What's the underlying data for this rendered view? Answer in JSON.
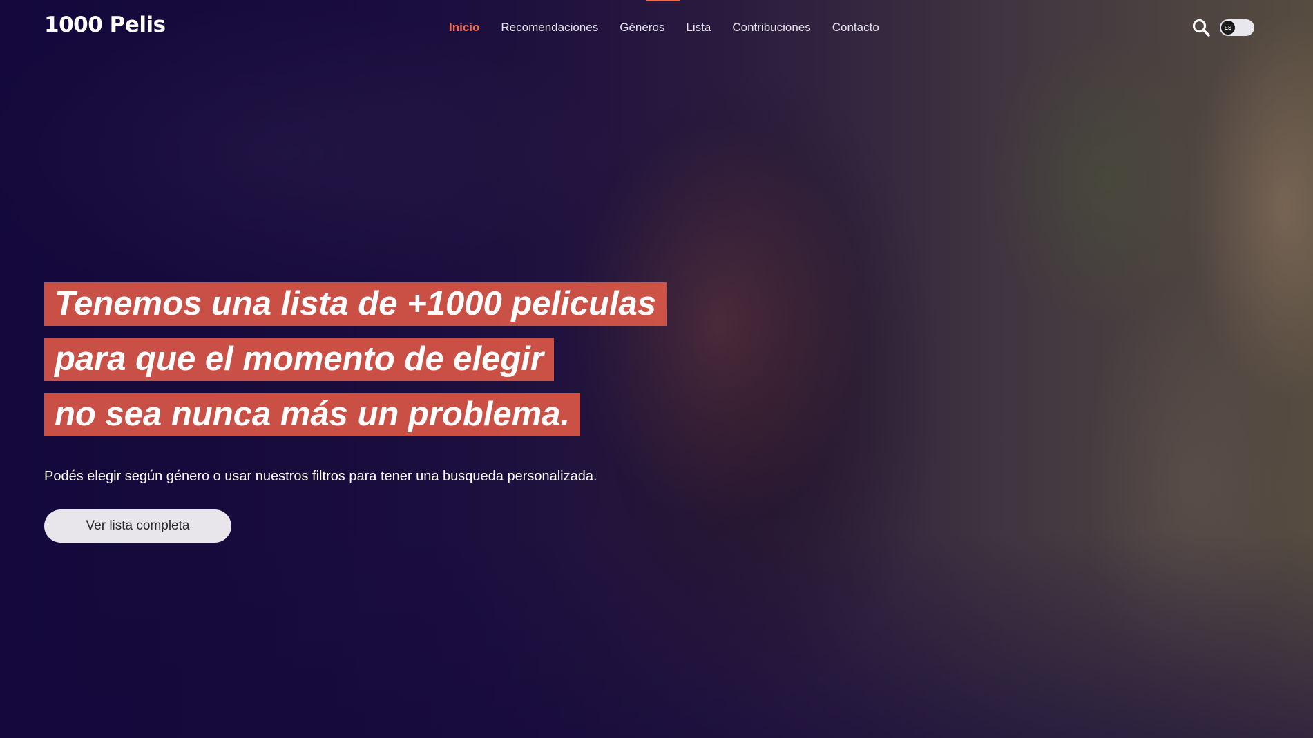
{
  "brand": {
    "logo_text": "1000 Pelis"
  },
  "nav": {
    "items": [
      {
        "label": "Inicio",
        "active": true
      },
      {
        "label": "Recomendaciones",
        "active": false
      },
      {
        "label": "Géneros",
        "active": false
      },
      {
        "label": "Lista",
        "active": false
      },
      {
        "label": "Contribuciones",
        "active": false
      },
      {
        "label": "Contacto",
        "active": false
      }
    ]
  },
  "header_actions": {
    "search_icon": "search-icon",
    "language_toggle": {
      "label": "ES",
      "state": "off"
    }
  },
  "hero": {
    "headline": {
      "line1_prefix": "Tenemos una lista de ",
      "line1_bold": "+1000",
      "line1_suffix": " peliculas",
      "line2": "para que el momento de elegir",
      "line3": "no sea nunca más un problema."
    },
    "subtitle": "Podés elegir según género o usar nuestros filtros para tener una busqueda personalizada.",
    "cta_label": "Ver lista completa"
  },
  "colors": {
    "accent": "#ef6a4e",
    "highlight_box": "#e25a48",
    "button_bg": "#e8e6ea",
    "overlay": "#14083c"
  }
}
